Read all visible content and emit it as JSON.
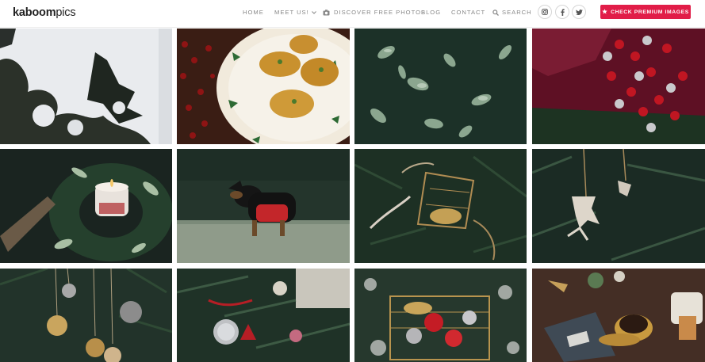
{
  "header": {
    "logo_bold": "kaboom",
    "logo_light": "pics",
    "nav": {
      "home": "HOME",
      "meet": "MEET US!",
      "discover": "DISCOVER FREE PHOTOS",
      "blog": "BLOG",
      "contact": "CONTACT",
      "search": "SEARCH"
    },
    "premium_button": "CHECK PREMIUM IMAGES",
    "social": [
      "instagram-icon",
      "facebook-icon",
      "twitter-icon"
    ]
  },
  "colors": {
    "accent": "#e11d48",
    "nav_text": "#888888"
  },
  "photos": [
    "snow-on-evergreen-photo",
    "christmas-pastries-on-holly-plate-photo",
    "frosted-green-leaves-photo",
    "red-baubles-on-velvet-photo",
    "candle-in-wreath-photo",
    "dachshund-in-red-sweater-photo",
    "golden-sleigh-ornament-photo",
    "reindeer-ornament-on-tree-photo",
    "hanging-gold-baubles-photo",
    "ornaments-on-christmas-tree-photo",
    "gold-basket-with-ornaments-photo",
    "coffee-and-notebook-on-table-photo"
  ]
}
